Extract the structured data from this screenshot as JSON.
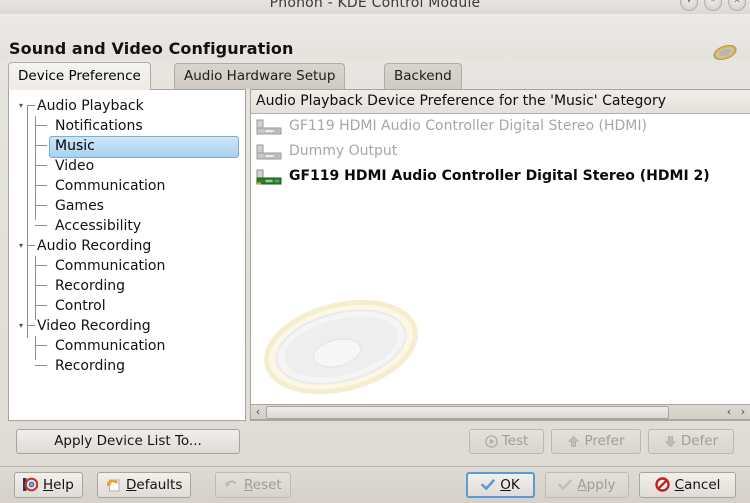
{
  "window": {
    "title": "Phonon - KDE Control Module",
    "controls": [
      {
        "name": "shade-button",
        "glyph": "▾"
      },
      {
        "name": "minimize-button",
        "glyph": "–"
      },
      {
        "name": "close-button",
        "glyph": "✕"
      }
    ]
  },
  "header": {
    "title": "Sound and Video Configuration",
    "icon": "speaker-icon"
  },
  "tabs": [
    {
      "label": "Device Preference",
      "active": true
    },
    {
      "label": "Audio Hardware Setup",
      "active": false
    },
    {
      "label": "Backend",
      "active": false
    }
  ],
  "tree": {
    "nodes": [
      {
        "label": "Audio Playback",
        "level": 0,
        "expanded": true,
        "selected": false
      },
      {
        "label": "Notifications",
        "level": 1,
        "selected": false
      },
      {
        "label": "Music",
        "level": 1,
        "selected": true
      },
      {
        "label": "Video",
        "level": 1,
        "selected": false
      },
      {
        "label": "Communication",
        "level": 1,
        "selected": false
      },
      {
        "label": "Games",
        "level": 1,
        "selected": false
      },
      {
        "label": "Accessibility",
        "level": 1,
        "selected": false
      },
      {
        "label": "Audio Recording",
        "level": 0,
        "expanded": true,
        "selected": false
      },
      {
        "label": "Communication",
        "level": 1,
        "selected": false
      },
      {
        "label": "Recording",
        "level": 1,
        "selected": false
      },
      {
        "label": "Control",
        "level": 1,
        "selected": false
      },
      {
        "label": "Video Recording",
        "level": 0,
        "expanded": true,
        "selected": false
      },
      {
        "label": "Communication",
        "level": 1,
        "selected": false
      },
      {
        "label": "Recording",
        "level": 1,
        "selected": false
      }
    ]
  },
  "devices": {
    "header": "Audio Playback Device Preference for the 'Music' Category",
    "items": [
      {
        "label": "GF119 HDMI Audio Controller Digital Stereo (HDMI)",
        "enabled": false,
        "icon": "soundcard-icon-disabled"
      },
      {
        "label": "Dummy Output",
        "enabled": false,
        "icon": "soundcard-icon-disabled"
      },
      {
        "label": "GF119 HDMI Audio Controller Digital Stereo (HDMI 2)",
        "enabled": true,
        "icon": "soundcard-icon-enabled"
      }
    ]
  },
  "scrollbar": {
    "left_arrow": "‹",
    "right_arrow_1": "‹",
    "right_arrow_2": "›"
  },
  "mid_buttons": {
    "apply_device_list": {
      "label": "Apply Device List To...",
      "enabled": true
    },
    "test": {
      "label": "Test",
      "enabled": false,
      "icon": "play-icon"
    },
    "prefer": {
      "label": "Prefer",
      "enabled": false,
      "icon": "arrow-up-icon"
    },
    "defer": {
      "label": "Defer",
      "enabled": false,
      "icon": "arrow-down-icon"
    }
  },
  "dialog_buttons": {
    "help": {
      "label": "Help",
      "accel": "H",
      "enabled": true,
      "icon": "help-lifebuoy-icon"
    },
    "defaults": {
      "label": "Defaults",
      "accel": "D",
      "enabled": true,
      "icon": "undo-document-icon"
    },
    "reset": {
      "label": "Reset",
      "accel": "R",
      "enabled": false,
      "icon": "undo-icon"
    },
    "ok": {
      "label": "OK",
      "accel": "O",
      "enabled": true,
      "focused": true,
      "icon": "check-icon"
    },
    "apply": {
      "label": "Apply",
      "accel": "A",
      "enabled": false,
      "icon": "check-icon"
    },
    "cancel": {
      "label": "Cancel",
      "accel": "C",
      "enabled": true,
      "icon": "cancel-icon"
    }
  },
  "colors": {
    "selection": "#a8d1ef",
    "focus_ring": "#5b9bd5",
    "window_bg": "#e4e1dc",
    "panel_bg": "#ffffff",
    "disabled_text": "#a6a6a6",
    "cancel_red": "#c0231f",
    "enabled_card_green": "#3d8b33"
  }
}
